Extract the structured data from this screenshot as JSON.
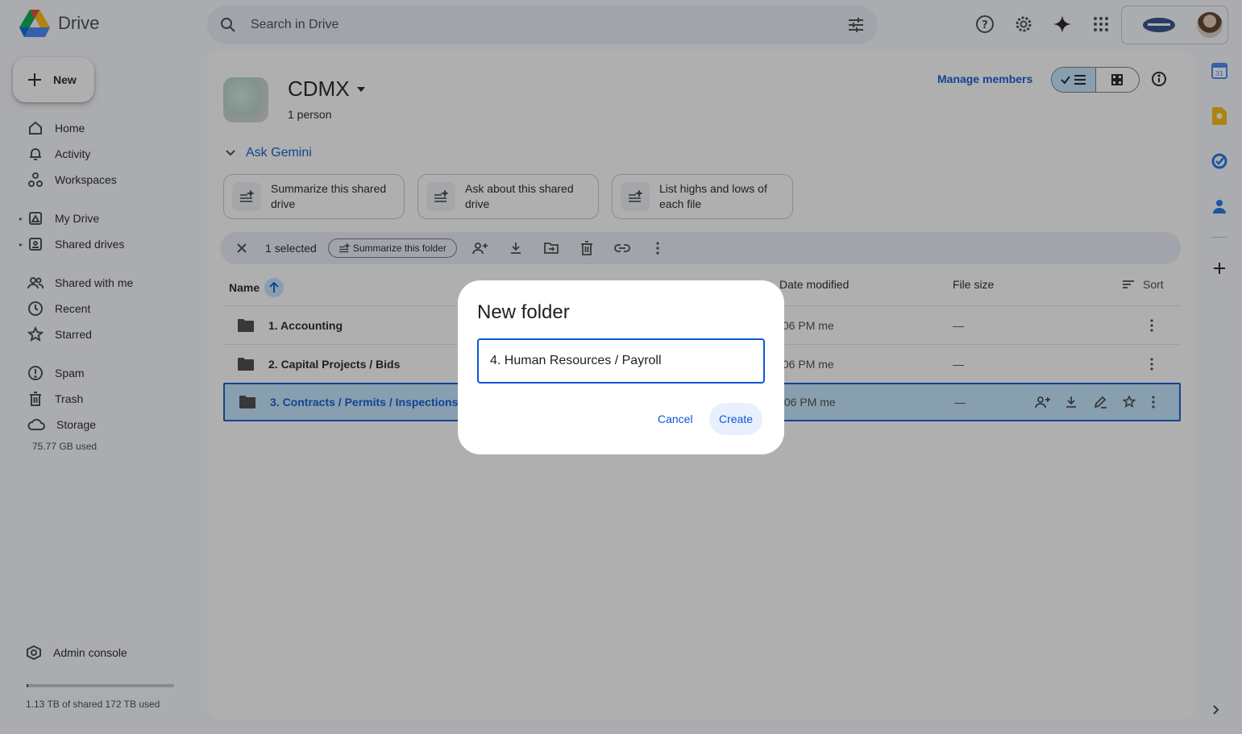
{
  "app": {
    "name": "Drive"
  },
  "search": {
    "placeholder": "Search in Drive"
  },
  "sidebar": {
    "new_label": "New",
    "items": [
      {
        "label": "Home"
      },
      {
        "label": "Activity"
      },
      {
        "label": "Workspaces"
      },
      {
        "label": "My Drive"
      },
      {
        "label": "Shared drives"
      },
      {
        "label": "Shared with me"
      },
      {
        "label": "Recent"
      },
      {
        "label": "Starred"
      },
      {
        "label": "Spam"
      },
      {
        "label": "Trash"
      },
      {
        "label": "Storage"
      }
    ],
    "storage_used": "75.77 GB used",
    "admin_label": "Admin console",
    "quota_text": "1.13 TB of shared 172 TB used",
    "quota_fraction": 0.0066
  },
  "drive": {
    "name": "CDMX",
    "members": "1 person",
    "manage_label": "Manage members"
  },
  "gemini": {
    "label": "Ask Gemini",
    "chips": [
      {
        "label": "Summarize this shared drive"
      },
      {
        "label": "Ask about this shared drive"
      },
      {
        "label": "List highs and lows of each file"
      }
    ]
  },
  "selection": {
    "count_label": "1 selected",
    "summarize_label": "Summarize this folder"
  },
  "table": {
    "headers": {
      "name": "Name",
      "date": "Date modified",
      "size": "File size",
      "sort": "Sort"
    },
    "rows": [
      {
        "name": "1. Accounting",
        "date": ":06 PM me",
        "size": "—",
        "selected": false
      },
      {
        "name": "2. Capital Projects / Bids",
        "date": ":06 PM me",
        "size": "—",
        "selected": false
      },
      {
        "name": "3. Contracts / Permits / Inspections",
        "date": ":06 PM me",
        "size": "—",
        "selected": true
      }
    ]
  },
  "dialog": {
    "title": "New folder",
    "input_value": "4. Human Resources / Payroll",
    "cancel_label": "Cancel",
    "create_label": "Create"
  },
  "colors": {
    "accent": "#0b57d0",
    "selected_bg": "#c2e7ff",
    "surface": "#f8fafd"
  }
}
